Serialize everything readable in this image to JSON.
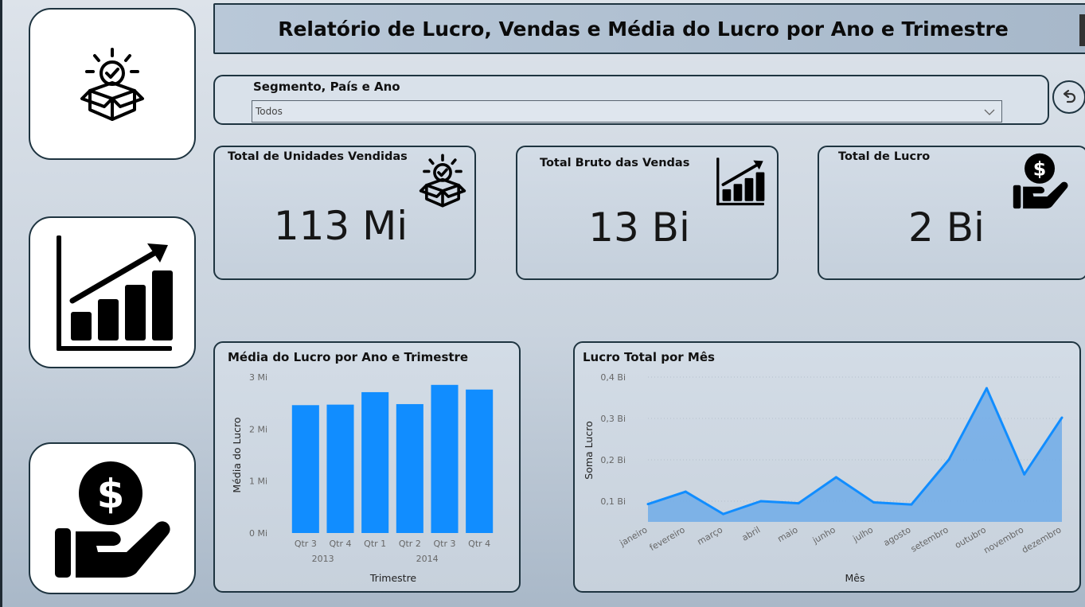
{
  "title": "Relatório de Lucro, Vendas e Média do Lucro por Ano e Trimestre",
  "side_icons": [
    "box-check-icon",
    "bar-chart-growth-icon",
    "dollar-hand-icon"
  ],
  "slicer": {
    "label": "Segmento, País e Ano",
    "value": "Todos"
  },
  "kpis": [
    {
      "title": "Total de Unidades Vendidas",
      "value": "113 Mi",
      "icon": "box-check-icon"
    },
    {
      "title": "Total Bruto das Vendas",
      "value": "13 Bi",
      "icon": "bar-chart-growth-icon"
    },
    {
      "title": "Total de Lucro",
      "value": "2 Bi",
      "icon": "dollar-hand-icon"
    }
  ],
  "chart_data": [
    {
      "type": "bar",
      "title": "Média do Lucro por Ano e Trimestre",
      "xlabel": "Trimestre",
      "ylabel": "Média do Lucro",
      "categories": [
        "Qtr 3",
        "Qtr 4",
        "Qtr 1",
        "Qtr 2",
        "Qtr 3",
        "Qtr 4"
      ],
      "groups": [
        {
          "label": "2013",
          "count": 2
        },
        {
          "label": "2014",
          "count": 4
        }
      ],
      "values": [
        2.46,
        2.47,
        2.71,
        2.48,
        2.85,
        2.76
      ],
      "unit": "Mi",
      "yticks": [
        "0 Mi",
        "1 Mi",
        "2 Mi",
        "3 Mi"
      ],
      "ylim": [
        0,
        3
      ],
      "color": "#118dff"
    },
    {
      "type": "area",
      "title": "Lucro Total por Mês",
      "xlabel": "Mês",
      "ylabel": "Soma Lucro",
      "categories": [
        "janeiro",
        "fevereiro",
        "março",
        "abril",
        "maio",
        "junho",
        "julho",
        "agosto",
        "setembro",
        "outubro",
        "novembro",
        "dezembro"
      ],
      "values": [
        0.093,
        0.123,
        0.069,
        0.1,
        0.095,
        0.158,
        0.097,
        0.092,
        0.201,
        0.373,
        0.165,
        0.302
      ],
      "unit": "Bi",
      "yticks": [
        "0,1 Bi",
        "0,2 Bi",
        "0,3 Bi",
        "0,4 Bi"
      ],
      "ylim": [
        0.05,
        0.4
      ],
      "line_color": "#118dff",
      "fill_color": "#74aee8"
    }
  ]
}
